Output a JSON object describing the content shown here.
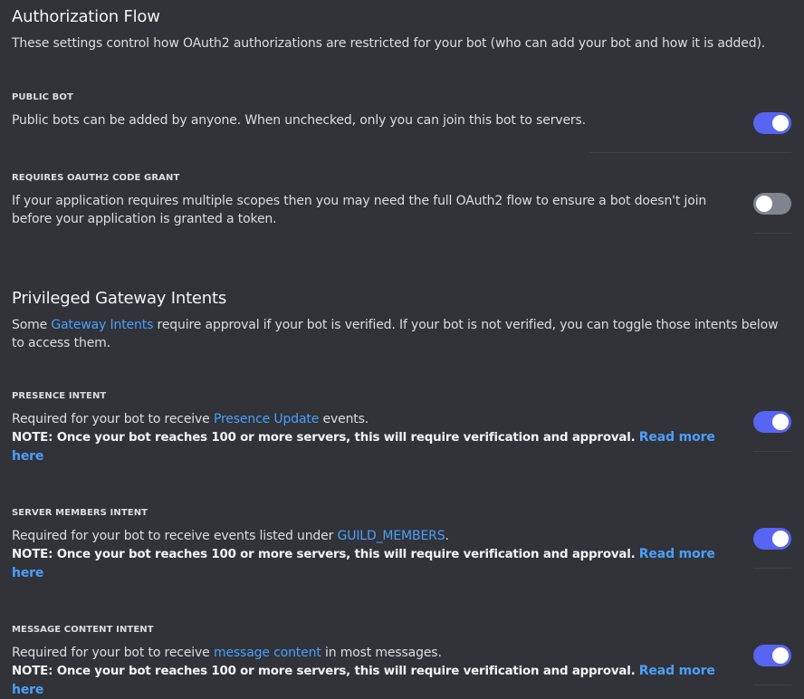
{
  "authorization": {
    "title": "Authorization Flow",
    "description": "These settings control how OAuth2 authorizations are restricted for your bot (who can add your bot and how it is added).",
    "public_bot": {
      "label": "PUBLIC BOT",
      "description": "Public bots can be added by anyone. When unchecked, only you can join this bot to servers.",
      "enabled": true
    },
    "code_grant": {
      "label": "REQUIRES OAUTH2 CODE GRANT",
      "description": "If your application requires multiple scopes then you may need the full OAuth2 flow to ensure a bot doesn't join before your application is granted a token.",
      "enabled": false
    }
  },
  "intents": {
    "title": "Privileged Gateway Intents",
    "description_before": "Some ",
    "description_link": "Gateway Intents",
    "description_after": " require approval if your bot is verified. If your bot is not verified, you can toggle those intents below to access them.",
    "presence": {
      "label": "PRESENCE INTENT",
      "text_before": "Required for your bot to receive ",
      "link": "Presence Update",
      "text_after": " events.",
      "note": "NOTE: Once your bot reaches 100 or more servers, this will require verification and approval.",
      "read_more": "Read more here",
      "enabled": true
    },
    "server_members": {
      "label": "SERVER MEMBERS INTENT",
      "text_before": "Required for your bot to receive events listed under ",
      "link": "GUILD_MEMBERS",
      "text_after": ".",
      "note": "NOTE: Once your bot reaches 100 or more servers, this will require verification and approval.",
      "read_more": "Read more here",
      "enabled": true
    },
    "message_content": {
      "label": "MESSAGE CONTENT INTENT",
      "text_before": "Required for your bot to receive ",
      "link": "message content",
      "text_after": " in most messages.",
      "note": "NOTE: Once your bot reaches 100 or more servers, this will require verification and approval.",
      "read_more": "Read more here",
      "enabled": true
    }
  },
  "colors": {
    "background": "#313338",
    "toggle_on": "#5865f2",
    "toggle_off": "#80848e",
    "link": "#4c9ffc",
    "divider": "#3f4147"
  }
}
